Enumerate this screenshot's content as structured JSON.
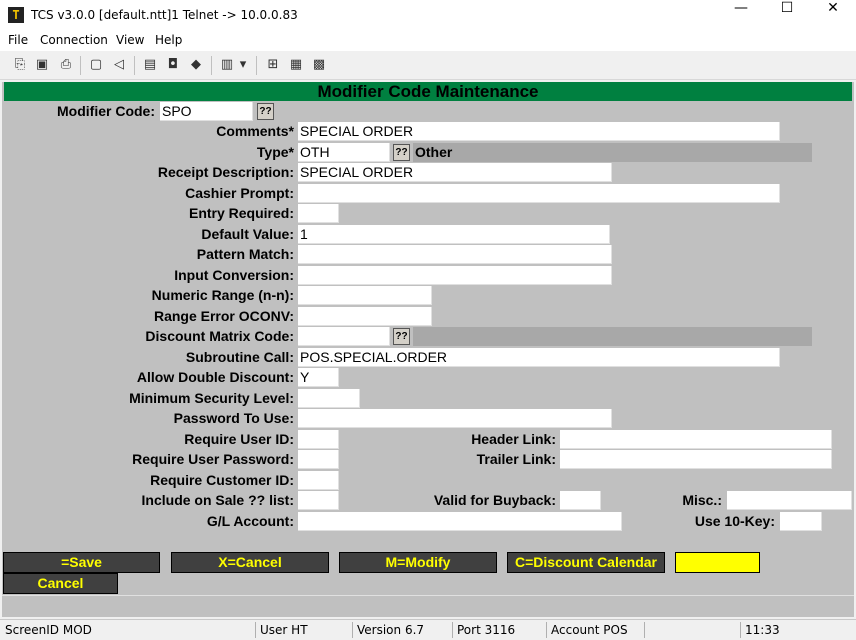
{
  "window": {
    "title": "TCS v3.0.0 [default.ntt]1 Telnet -> 10.0.0.83",
    "minimize": "—",
    "maximize": "☐",
    "close": "✕"
  },
  "menu": [
    "File",
    "Connection",
    "View",
    "Help"
  ],
  "toolbar_icons": [
    "copy-icon",
    "save-icon",
    "print-icon",
    "lock-icon",
    "sound-icon",
    "properties-icon",
    "monitor-icon",
    "book-icon",
    "page-icon",
    "dropdown-icon",
    "tree-icon",
    "chart-icon",
    "calculator-icon"
  ],
  "screen": {
    "header": "Modifier Code Maintenance",
    "modifier_code": {
      "label": "Modifier Code:",
      "value": "SPO",
      "lookup": "??"
    },
    "fields": {
      "comments": {
        "label": "Comments*",
        "value": "SPECIAL ORDER"
      },
      "type": {
        "label": "Type*",
        "value": "OTH",
        "lookup": "??",
        "desc": "Other"
      },
      "receipt_description": {
        "label": "Receipt Description:",
        "value": "SPECIAL ORDER"
      },
      "cashier_prompt": {
        "label": "Cashier Prompt:",
        "value": ""
      },
      "entry_required": {
        "label": "Entry Required:",
        "value": ""
      },
      "default_value": {
        "label": "Default Value:",
        "value": "1"
      },
      "pattern_match": {
        "label": "Pattern Match:",
        "value": ""
      },
      "input_conversion": {
        "label": "Input Conversion:",
        "value": ""
      },
      "numeric_range": {
        "label": "Numeric Range (n-n):",
        "value": ""
      },
      "range_error_oconv": {
        "label": "Range Error OCONV:",
        "value": ""
      },
      "discount_matrix_code": {
        "label": "Discount Matrix Code:",
        "value": "",
        "lookup": "??",
        "desc": ""
      },
      "subroutine_call": {
        "label": "Subroutine Call:",
        "value": "POS.SPECIAL.ORDER"
      },
      "allow_double_discount": {
        "label": "Allow Double Discount:",
        "value": "Y"
      },
      "minimum_security_level": {
        "label": "Minimum Security Level:",
        "value": ""
      },
      "password_to_use": {
        "label": "Password To Use:",
        "value": ""
      },
      "require_user_id": {
        "label": "Require User ID:",
        "value": ""
      },
      "require_user_password": {
        "label": "Require User Password:",
        "value": ""
      },
      "require_customer_id": {
        "label": "Require Customer ID:",
        "value": ""
      },
      "include_on_sale": {
        "label": "Include on Sale ?? list:",
        "value": ""
      },
      "gl_account": {
        "label": "G/L Account:",
        "value": ""
      },
      "header_link": {
        "label": "Header Link:",
        "value": ""
      },
      "trailer_link": {
        "label": "Trailer Link:",
        "value": ""
      },
      "valid_for_buyback": {
        "label": "Valid for Buyback:",
        "value": ""
      },
      "misc": {
        "label": "Misc.:",
        "value": ""
      },
      "use_10_key": {
        "label": "Use 10-Key:",
        "value": ""
      }
    },
    "buttons": {
      "save": "=Save",
      "x_cancel": "X=Cancel",
      "modify": "M=Modify",
      "discount_calendar": "C=Discount Calendar",
      "cancel": "Cancel"
    },
    "colors": {
      "header_bg": "#008040",
      "screen_bg": "#c0c0c0",
      "fkey_bg": "#404040",
      "fkey_text": "#ffff00"
    }
  },
  "status": {
    "screen_id": "ScreenID MOD",
    "user": "User HT",
    "version": "Version 6.7",
    "port": "Port 3116",
    "account": "Account POS",
    "time": "11:33"
  }
}
